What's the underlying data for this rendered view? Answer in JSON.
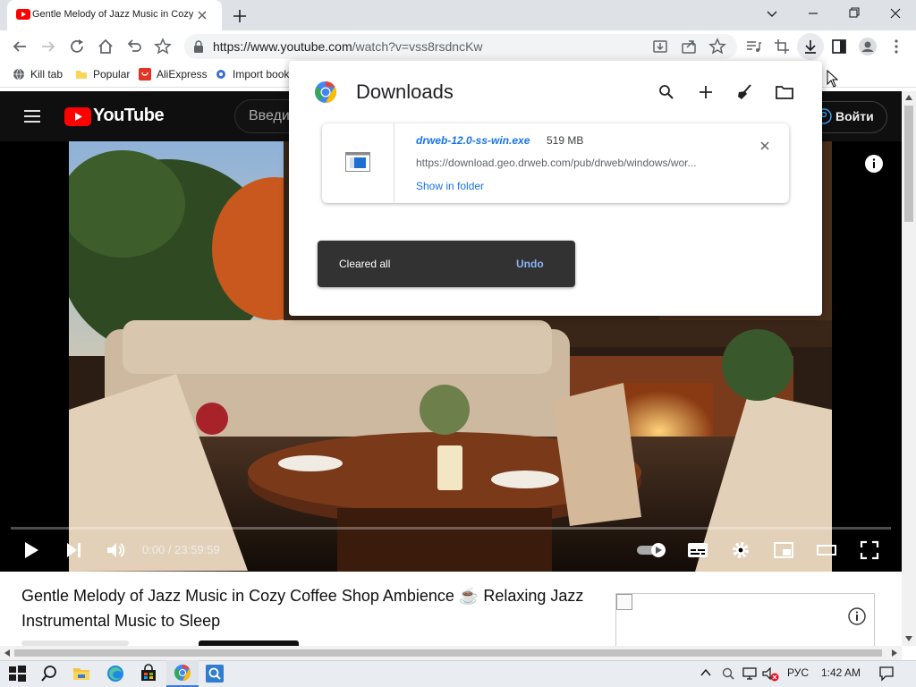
{
  "browser": {
    "tab_title": "Gentle Melody of Jazz Music in Cozy Coffee Shop",
    "url_host": "https://www.youtube.com",
    "url_path": "/watch?v=vss8rsdncKw"
  },
  "bookmarks": [
    {
      "label": "Kill tab",
      "icon": "globe-icon"
    },
    {
      "label": "Popular",
      "icon": "folder-icon"
    },
    {
      "label": "AliExpress",
      "icon": "aliexpress-icon"
    },
    {
      "label": "Import bookm",
      "icon": "gear-icon"
    }
  ],
  "youtube": {
    "logo_text": "YouTube",
    "search_placeholder": "Введи",
    "signin_label": "Войти",
    "time_display": "0:00 / 23:59:59",
    "video_title": "Gentle Melody of Jazz Music in Cozy Coffee Shop Ambience ☕ Relaxing Jazz Instrumental Music to Sleep"
  },
  "downloads": {
    "title": "Downloads",
    "filename": "drweb-12.0-ss-win.exe",
    "size": "519 MB",
    "url": "https://download.geo.drweb.com/pub/drweb/windows/wor...",
    "show_in_folder": "Show in folder",
    "toast_text": "Cleared all",
    "toast_undo": "Undo"
  },
  "taskbar": {
    "lang": "РУС",
    "time": "1:42 AM"
  },
  "colors": {
    "accent": "#1a73e8",
    "yt_red": "#ff0000",
    "toast_link": "#8ab4f8"
  }
}
